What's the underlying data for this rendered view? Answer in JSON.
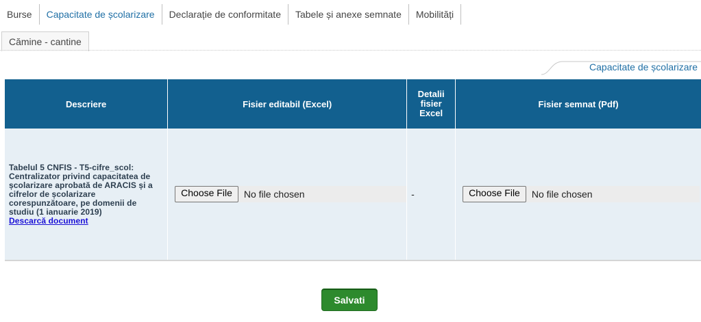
{
  "tabs": [
    {
      "label": "Burse",
      "active": false
    },
    {
      "label": "Capacitate de școlarizare",
      "active": true
    },
    {
      "label": "Declarație de conformitate",
      "active": false
    },
    {
      "label": "Tabele și anexe semnate",
      "active": false
    },
    {
      "label": "Mobilități",
      "active": false
    }
  ],
  "tab_row2": {
    "label": "Cămine - cantine"
  },
  "section_title": "Capacitate de școlarizare",
  "table": {
    "headers": [
      "Descriere",
      "Fisier editabil (Excel)",
      "Detalii fisier Excel",
      "Fisier semnat (Pdf)"
    ],
    "row": {
      "description": "Tabelul 5 CNFIS - T5-cifre_scol: Centralizator privind capacitatea de școlarizare aprobată de ARACIS și a cifrelor de școlarizare corespunzătoare, pe domenii de studiu (1 ianuarie 2019)",
      "download_link": "Descarcă document",
      "excel_button": "Choose File",
      "excel_status": "No file chosen",
      "details": "-",
      "pdf_button": "Choose File",
      "pdf_status": "No file chosen"
    }
  },
  "save_label": "Salvati",
  "colors": {
    "header": "#12608f",
    "row_bg": "#e7eff5",
    "save": "#2d8a2d",
    "link": "#1a10d6",
    "accent": "#1f6fa5"
  }
}
